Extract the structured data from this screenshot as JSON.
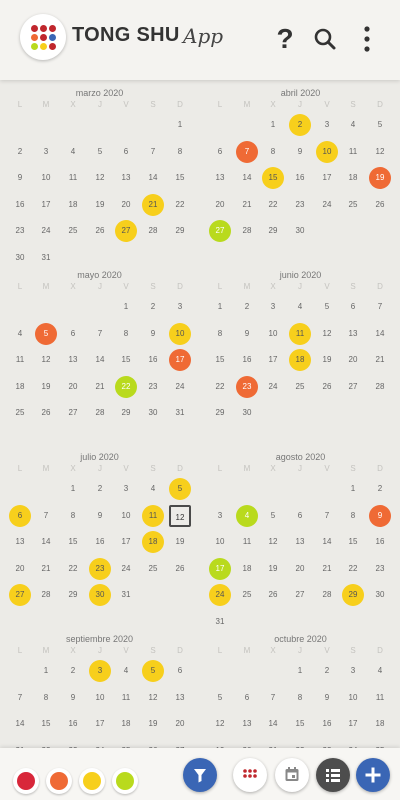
{
  "app": {
    "brand": "TONG SHU",
    "brand_suffix": "App"
  },
  "header": {
    "help_icon": "question-icon",
    "search_icon": "search-icon",
    "menu_icon": "more-vertical-icon"
  },
  "weekday_letters": [
    "L",
    "M",
    "X",
    "J",
    "V",
    "S",
    "D"
  ],
  "months": [
    {
      "name": "marzo 2020",
      "offset": 6,
      "days": 31,
      "marks": {
        "21": "y",
        "27": "y"
      }
    },
    {
      "name": "abril 2020",
      "offset": 2,
      "days": 30,
      "marks": {
        "2": "y",
        "7": "o",
        "10": "y",
        "15": "y",
        "19": "o",
        "27": "g"
      }
    },
    {
      "name": "mayo 2020",
      "offset": 4,
      "days": 31,
      "marks": {
        "5": "o",
        "10": "y",
        "17": "o",
        "22": "g"
      }
    },
    {
      "name": "junio 2020",
      "offset": 0,
      "days": 30,
      "marks": {
        "11": "y",
        "18": "y",
        "23": "o"
      }
    },
    {
      "name": "julio 2020",
      "offset": 2,
      "days": 31,
      "marks": {
        "5": "y",
        "6": "y",
        "11": "y",
        "18": "y",
        "23": "y",
        "27": "y",
        "30": "y"
      },
      "today": 12
    },
    {
      "name": "agosto 2020",
      "offset": 5,
      "days": 31,
      "marks": {
        "4": "g",
        "9": "o",
        "17": "g",
        "24": "y",
        "29": "y"
      }
    },
    {
      "name": "septiembre 2020",
      "offset": 1,
      "days": 30,
      "marks": {
        "3": "y",
        "5": "y"
      }
    },
    {
      "name": "octubre 2020",
      "offset": 3,
      "days": 31,
      "marks": {}
    }
  ],
  "colors": {
    "yellow": "#f7cf1c",
    "orange": "#ef6a35",
    "green": "#b9da1d",
    "red": "#d8273a",
    "blue": "#3a66b5",
    "dark": "#4d4d4d"
  },
  "bottom_bar": {
    "filters": [
      "red",
      "orange",
      "yellow",
      "green"
    ],
    "buttons": [
      "filter-icon",
      "grid-icon",
      "calendar-icon",
      "list-icon",
      "plus-icon"
    ]
  }
}
